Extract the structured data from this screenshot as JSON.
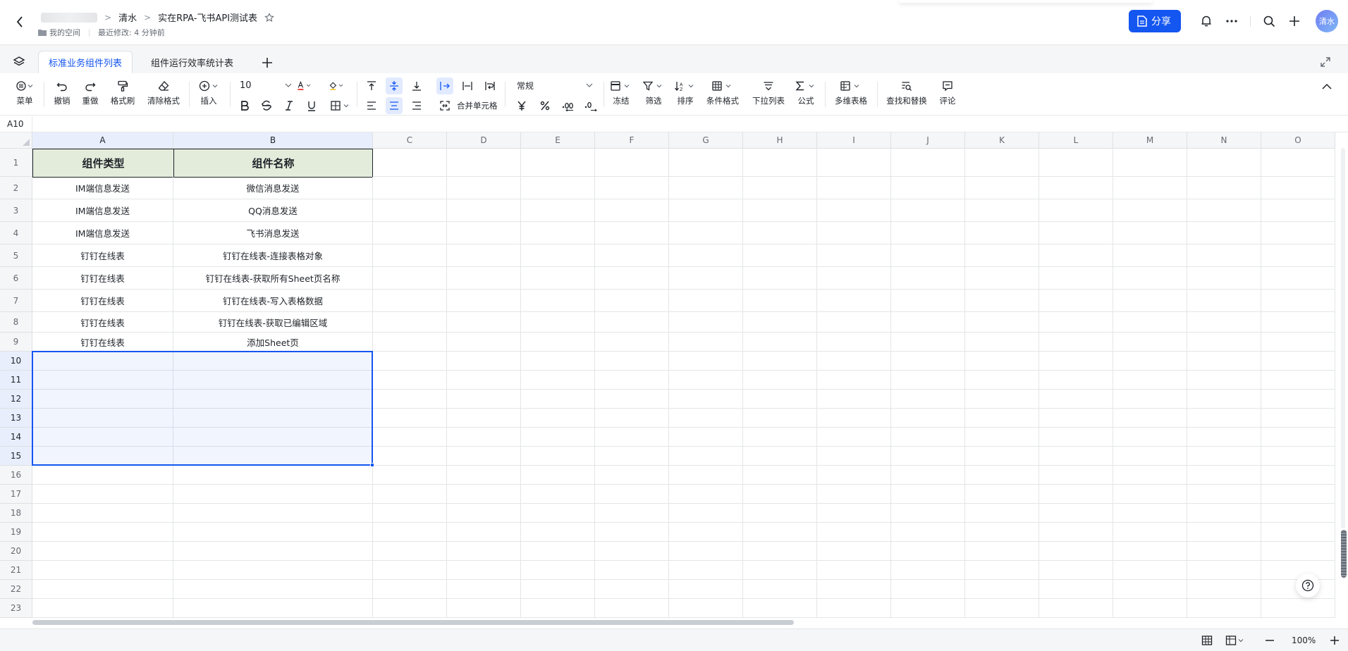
{
  "header": {
    "breadcrumbs": [
      "清水",
      "实在RPA-飞书API测试表"
    ],
    "location": "我的空间",
    "last_modified": "最近修改: 4 分钟前",
    "share_label": "分享",
    "avatar_text": "清水"
  },
  "tabs": [
    {
      "label": "标准业务组件列表",
      "active": true
    },
    {
      "label": "组件运行效率统计表",
      "active": false
    }
  ],
  "toolbar": {
    "menu": "菜单",
    "undo": "撤销",
    "redo": "重做",
    "format_painter": "格式刷",
    "clear_format": "清除格式",
    "insert": "插入",
    "font_size": "10",
    "merge_cells": "合并单元格",
    "number_format": "常规",
    "freeze": "冻结",
    "filter": "筛选",
    "sort": "排序",
    "conditional_format": "条件格式",
    "dropdown_list": "下拉列表",
    "formula": "公式",
    "multi_table": "多维表格",
    "find_replace": "查找和替换",
    "comment": "评论"
  },
  "namebar": {
    "cell_ref": "A10"
  },
  "columns": [
    "A",
    "B",
    "C",
    "D",
    "E",
    "F",
    "G",
    "H",
    "I",
    "J",
    "K",
    "L",
    "M",
    "N",
    "O"
  ],
  "rows": [
    "1",
    "2",
    "3",
    "4",
    "5",
    "6",
    "7",
    "8",
    "9",
    "10",
    "11",
    "12",
    "13",
    "14",
    "15",
    "16",
    "17",
    "18",
    "19",
    "20",
    "21",
    "22",
    "23"
  ],
  "table": {
    "headers": [
      "组件类型",
      "组件名称"
    ],
    "data": [
      [
        "IM端信息发送",
        "微信消息发送"
      ],
      [
        "IM端信息发送",
        "QQ消息发送"
      ],
      [
        "IM端信息发送",
        "飞书消息发送"
      ],
      [
        "钉钉在线表",
        "钉钉在线表-连接表格对象"
      ],
      [
        "钉钉在线表",
        "钉钉在线表-获取所有Sheet页名称"
      ],
      [
        "钉钉在线表",
        "钉钉在线表-写入表格数据"
      ],
      [
        "钉钉在线表",
        "钉钉在线表-获取已编辑区域"
      ],
      [
        "钉钉在线表",
        "添加Sheet页"
      ]
    ]
  },
  "footer": {
    "zoom": "100%"
  },
  "colors": {
    "accent": "#1456f0",
    "header_fill": "#e3ecdb"
  }
}
